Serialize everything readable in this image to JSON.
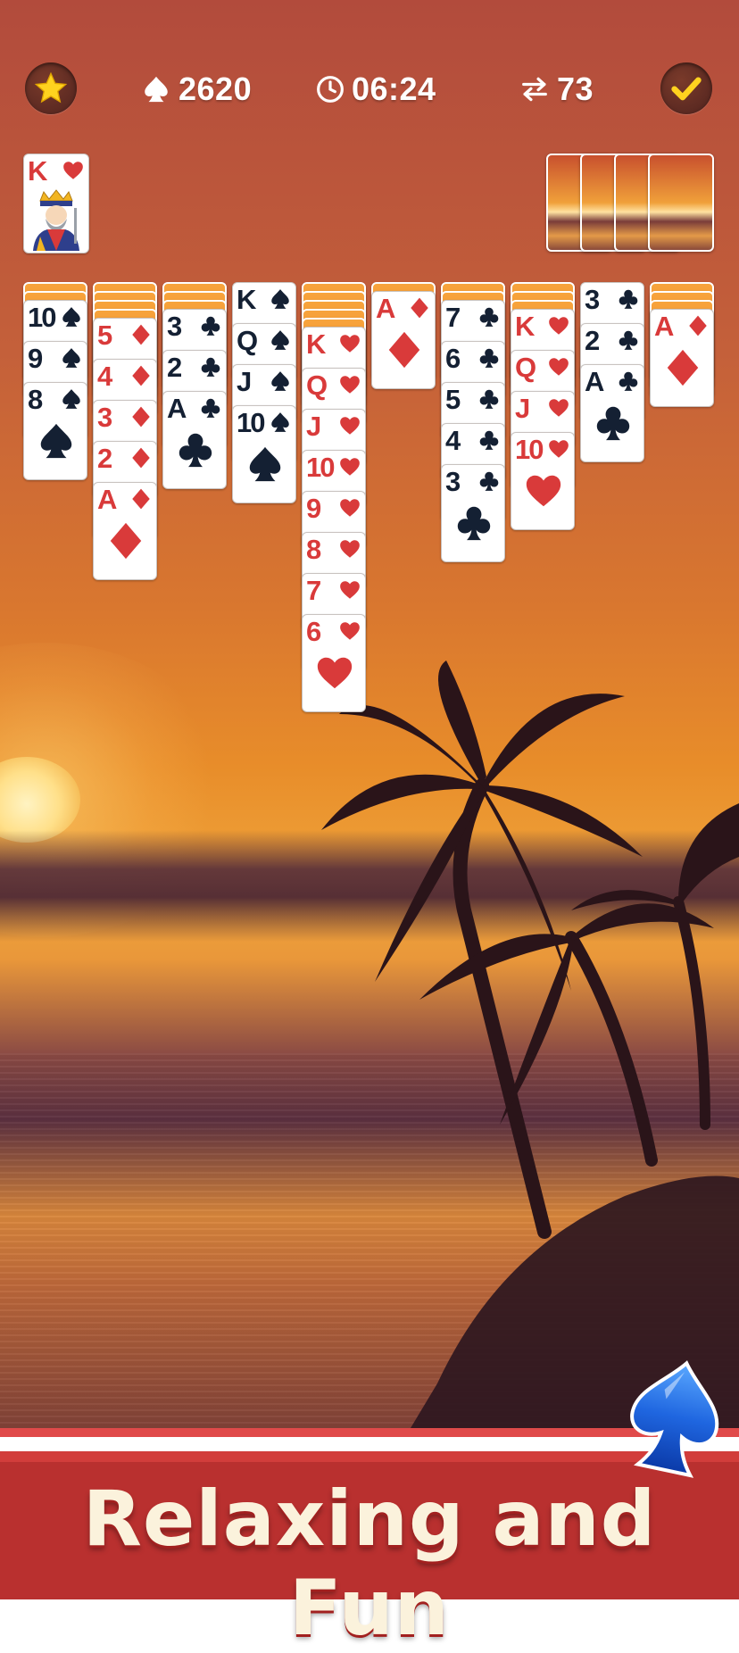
{
  "hud": {
    "score": "2620",
    "timer": "06:24",
    "moves": "73"
  },
  "foundation": {
    "completed": [
      {
        "rank": "K",
        "suit": "hearts"
      }
    ]
  },
  "stock": {
    "remaining_piles": 4
  },
  "tableau": [
    {
      "hidden": 2,
      "cards": [
        {
          "rank": "10",
          "suit": "spades"
        },
        {
          "rank": "9",
          "suit": "spades"
        },
        {
          "rank": "8",
          "suit": "spades"
        }
      ]
    },
    {
      "hidden": 4,
      "cards": [
        {
          "rank": "5",
          "suit": "diamonds"
        },
        {
          "rank": "4",
          "suit": "diamonds"
        },
        {
          "rank": "3",
          "suit": "diamonds"
        },
        {
          "rank": "2",
          "suit": "diamonds"
        },
        {
          "rank": "A",
          "suit": "diamonds"
        }
      ]
    },
    {
      "hidden": 3,
      "cards": [
        {
          "rank": "3",
          "suit": "clubs"
        },
        {
          "rank": "2",
          "suit": "clubs"
        },
        {
          "rank": "A",
          "suit": "clubs"
        }
      ]
    },
    {
      "hidden": 0,
      "cards": [
        {
          "rank": "K",
          "suit": "spades"
        },
        {
          "rank": "Q",
          "suit": "spades"
        },
        {
          "rank": "J",
          "suit": "spades"
        },
        {
          "rank": "10",
          "suit": "spades"
        }
      ]
    },
    {
      "hidden": 5,
      "cards": [
        {
          "rank": "K",
          "suit": "hearts"
        },
        {
          "rank": "Q",
          "suit": "hearts"
        },
        {
          "rank": "J",
          "suit": "hearts"
        },
        {
          "rank": "10",
          "suit": "hearts"
        },
        {
          "rank": "9",
          "suit": "hearts"
        },
        {
          "rank": "8",
          "suit": "hearts"
        },
        {
          "rank": "7",
          "suit": "hearts"
        },
        {
          "rank": "6",
          "suit": "hearts"
        }
      ]
    },
    {
      "hidden": 1,
      "cards": [
        {
          "rank": "A",
          "suit": "diamonds"
        }
      ]
    },
    {
      "hidden": 2,
      "cards": [
        {
          "rank": "7",
          "suit": "clubs"
        },
        {
          "rank": "6",
          "suit": "clubs"
        },
        {
          "rank": "5",
          "suit": "clubs"
        },
        {
          "rank": "4",
          "suit": "clubs"
        },
        {
          "rank": "3",
          "suit": "clubs"
        }
      ]
    },
    {
      "hidden": 3,
      "cards": [
        {
          "rank": "K",
          "suit": "hearts"
        },
        {
          "rank": "Q",
          "suit": "hearts"
        },
        {
          "rank": "J",
          "suit": "hearts"
        },
        {
          "rank": "10",
          "suit": "hearts"
        }
      ]
    },
    {
      "hidden": 0,
      "cards": [
        {
          "rank": "3",
          "suit": "clubs"
        },
        {
          "rank": "2",
          "suit": "clubs"
        },
        {
          "rank": "A",
          "suit": "clubs"
        }
      ]
    },
    {
      "hidden": 3,
      "cards": [
        {
          "rank": "A",
          "suit": "diamonds"
        }
      ]
    }
  ],
  "banner": {
    "text": "Relaxing and Fun"
  },
  "icons": {
    "star": "star-icon",
    "spade": "spade-icon",
    "clock": "clock-icon",
    "moves": "swap-arrows-icon",
    "check": "checkmark-icon"
  },
  "colors": {
    "red_suit": "#d93a3a",
    "black_suit": "#142033",
    "banner": "#b9302f",
    "banner_text": "#fbf2dc",
    "card_back": "#f48a2c"
  }
}
